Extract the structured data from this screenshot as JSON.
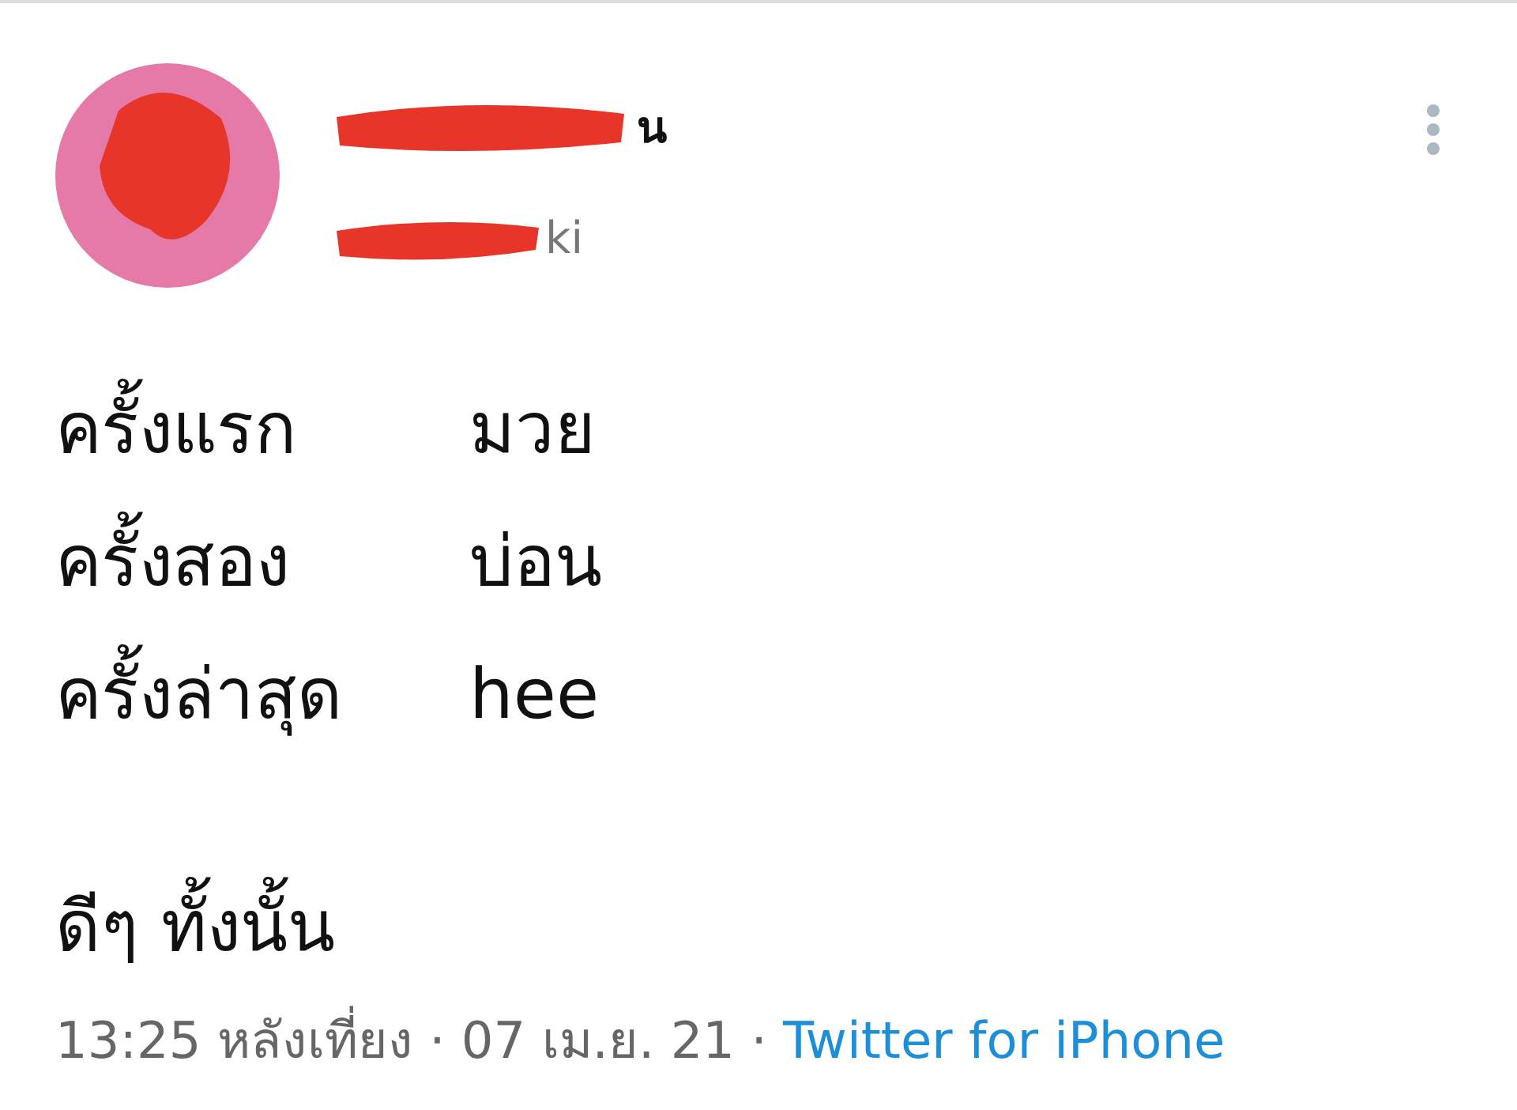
{
  "tweet": {
    "author": {
      "name_visible": "น",
      "handle_visible": "ki",
      "redacted": true
    },
    "lines": [
      {
        "label": "ครั้งแรก",
        "value": "มวย"
      },
      {
        "label": "ครั้งสอง",
        "value": "บ่อน"
      },
      {
        "label": "ครั้งล่าสุด",
        "value": "hee"
      }
    ],
    "closing": "ดีๆ ทั้งนั้น",
    "meta": {
      "time": "13:25 หลังเที่ยง · 07 เม.ย. 21 · ",
      "source": "Twitter for iPhone"
    }
  }
}
